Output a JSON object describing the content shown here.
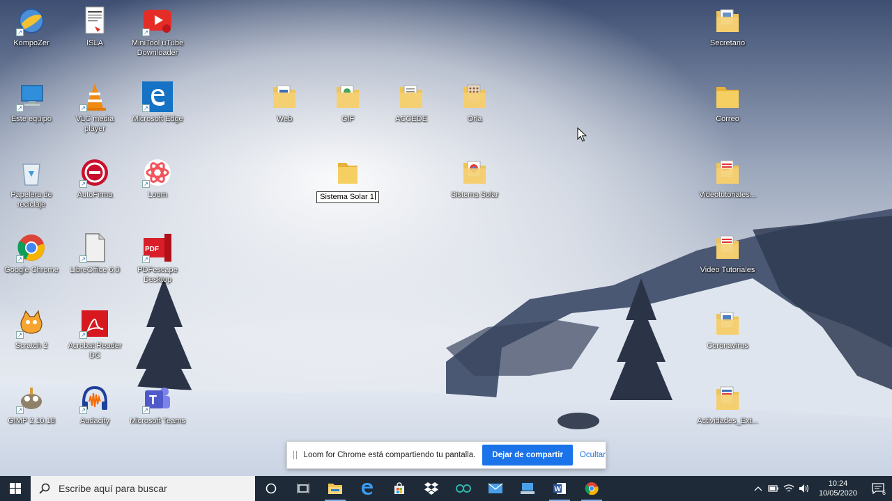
{
  "desktop": {
    "icons": [
      {
        "label": "KompoZer"
      },
      {
        "label": "ISLA"
      },
      {
        "label": "MiniTool uTube Downloader"
      },
      {
        "label": "Este equipo"
      },
      {
        "label": "VLC media player"
      },
      {
        "label": "Microsoft Edge"
      },
      {
        "label": "Papelera de reciclaje"
      },
      {
        "label": "AutoFirma"
      },
      {
        "label": "Loom"
      },
      {
        "label": "Google Chrome"
      },
      {
        "label": "LibreOffice 6.0"
      },
      {
        "label": "PDFescape Desktop"
      },
      {
        "label": "Scratch 2"
      },
      {
        "label": "Acrobat Reader DC"
      },
      {
        "label": "GIMP 2.10.18"
      },
      {
        "label": "Audacity"
      },
      {
        "label": "Microsoft Teams"
      },
      {
        "label": "Web"
      },
      {
        "label": "GIF"
      },
      {
        "label": "ACCEDE"
      },
      {
        "label": "Orla"
      },
      {
        "label": "Sistema Solar"
      },
      {
        "label": "Secretario"
      },
      {
        "label": "Correo"
      },
      {
        "label": "Videotutoriales..."
      },
      {
        "label": "Video Tutoriales"
      },
      {
        "label": "Coronavirus"
      },
      {
        "label": "Actividades_Ext..."
      }
    ],
    "renaming_folder": {
      "value": "Sistema Solar 1"
    }
  },
  "share_bar": {
    "message": "Loom for Chrome está compartiendo tu pantalla.",
    "stop_label": "Dejar de compartir",
    "hide_label": "Ocultar"
  },
  "taskbar": {
    "search_placeholder": "Escribe aquí para buscar",
    "apps": [
      "cortana-icon",
      "task-view-icon",
      "file-explorer-icon",
      "edge-icon",
      "store-icon",
      "dropbox-icon",
      "arduino-icon",
      "mail-icon",
      "computer-icon",
      "word-icon",
      "chrome-icon"
    ],
    "time": "10:24",
    "date": "10/05/2020",
    "notification_count": "6"
  },
  "colors": {
    "taskbar": "#1e2a38",
    "accent": "#1a73e8",
    "folder": "#f0c454"
  }
}
